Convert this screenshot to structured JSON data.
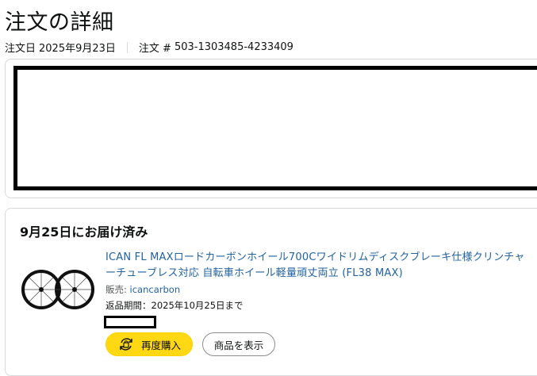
{
  "page": {
    "title": "注文の詳細",
    "order_date_label": "注文日",
    "order_date": "2025年9月23日",
    "order_number_label": "注文 #",
    "order_number": "503-1303485-4233409"
  },
  "shipment": {
    "status": "9月25日にお届け済み",
    "item": {
      "title": "ICAN FL MAXロードカーボンホイール700Cワイドリムディスクブレーキ仕様クリンチャーチューブレス対応 自転車ホイール軽量頑丈両立 (FL38 MAX)",
      "seller_label": "販売:",
      "seller_name": "icancarbon",
      "return_window": "返品期間：2025年10月25日まで",
      "image_icon": "bicycle-wheels-icon"
    },
    "buttons": {
      "buy_again": "再度購入",
      "view_item": "商品を表示",
      "buy_again_icon": "rebuy-icon"
    }
  },
  "colors": {
    "link": "#2162a1",
    "buy_button": "#ffd814",
    "border": "#d5d9d9",
    "text": "#0f1111",
    "muted": "#565959"
  }
}
